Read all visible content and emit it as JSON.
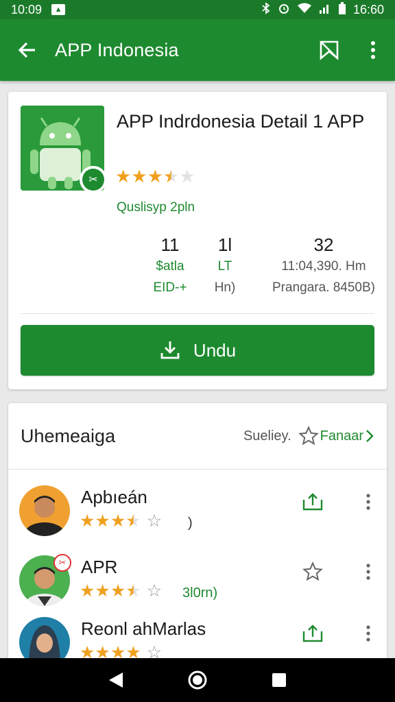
{
  "status_bar": {
    "time_left": "10:09",
    "time_right": "16:60",
    "icons": [
      "notification-icon",
      "bluetooth-icon",
      "alarm-icon",
      "wifi-icon",
      "signal-icon",
      "battery-icon"
    ]
  },
  "app_bar": {
    "title": "APP Indonesia",
    "icons": [
      "back-arrow-icon",
      "bookmark-icon",
      "more-vert-icon"
    ]
  },
  "detail": {
    "app_name": "APP Indrdonesia Detail 1 APP",
    "rating_stars": 3.5,
    "developer": "Quslisyp 2pln",
    "stats": [
      {
        "big": "11",
        "line1": "$atla",
        "line2": "EID-+"
      },
      {
        "big": "1l",
        "line1": "LT",
        "line2": "Hn)"
      },
      {
        "big": "32",
        "line1": "11:04,390. Hm",
        "line2": "Prangara. 8450B)"
      }
    ],
    "install_label": "Undu"
  },
  "reviews": {
    "title": "Uhemeaiga",
    "sort_label": "Sueliey.",
    "fav_label": "Fanaar",
    "items": [
      {
        "name": "Apbıeán",
        "stars": 3.5,
        "count": ")",
        "action_icon": "share-icon"
      },
      {
        "name": "APR",
        "stars": 3.5,
        "count": "3l0rn)",
        "action_icon": "star-outline-icon"
      },
      {
        "name": "Reonl ahMarlas",
        "stars": 4,
        "count": "",
        "action_icon": "share-icon"
      }
    ]
  },
  "colors": {
    "status_bar": "#1b7a2a",
    "app_bar": "#1e8a30",
    "accent": "#1e8a30",
    "star": "#f0a020"
  }
}
